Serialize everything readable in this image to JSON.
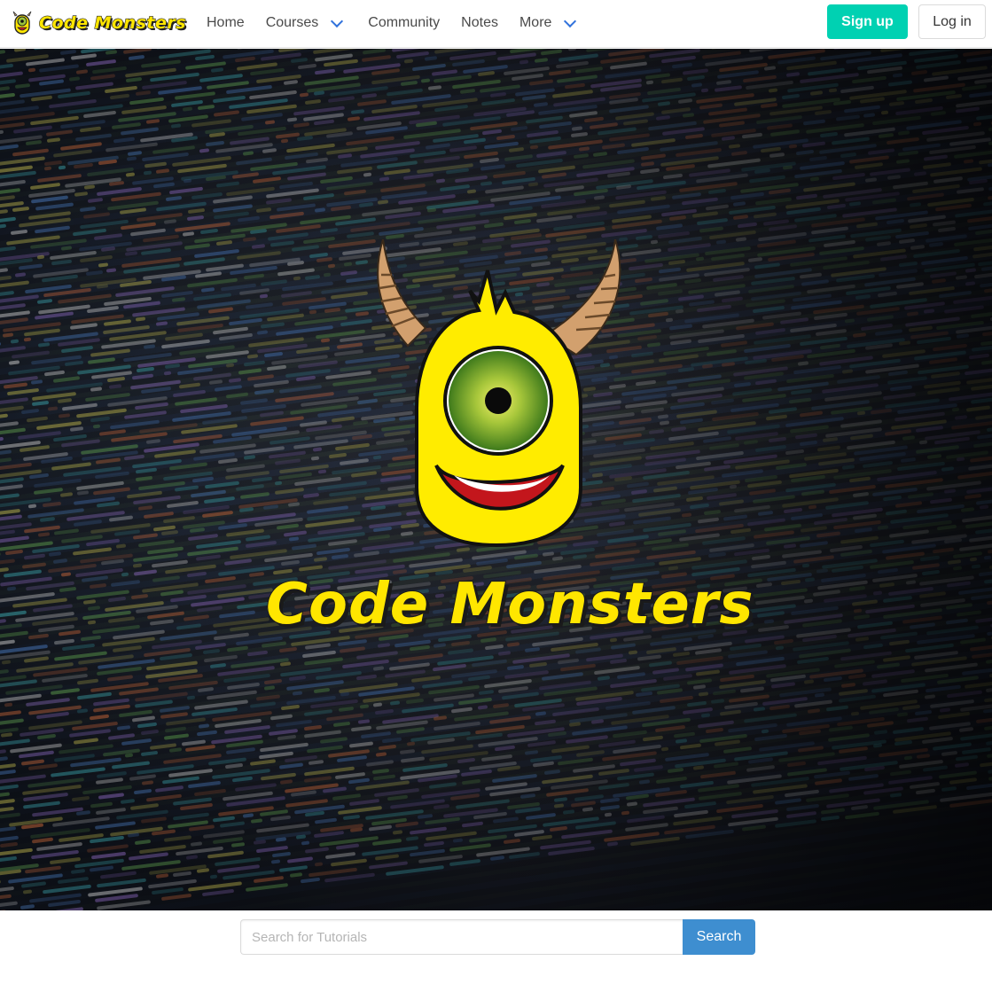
{
  "colors": {
    "brand_yellow": "#ffe600",
    "signup": "#00d1b2",
    "search_button": "#3e8ed0",
    "chevron": "#3273dc"
  },
  "navbar": {
    "brand": "Code Monsters",
    "links": [
      {
        "label": "Home",
        "dropdown": false
      },
      {
        "label": "Courses",
        "dropdown": true
      },
      {
        "label": "Community",
        "dropdown": false
      },
      {
        "label": "Notes",
        "dropdown": false
      },
      {
        "label": "More",
        "dropdown": true
      }
    ],
    "signup_label": "Sign up",
    "login_label": "Log in"
  },
  "hero": {
    "title": "Code Monsters",
    "logo_icon": "monster-logo-icon"
  },
  "search": {
    "placeholder": "Search for Tutorials",
    "value": "",
    "button_label": "Search"
  }
}
